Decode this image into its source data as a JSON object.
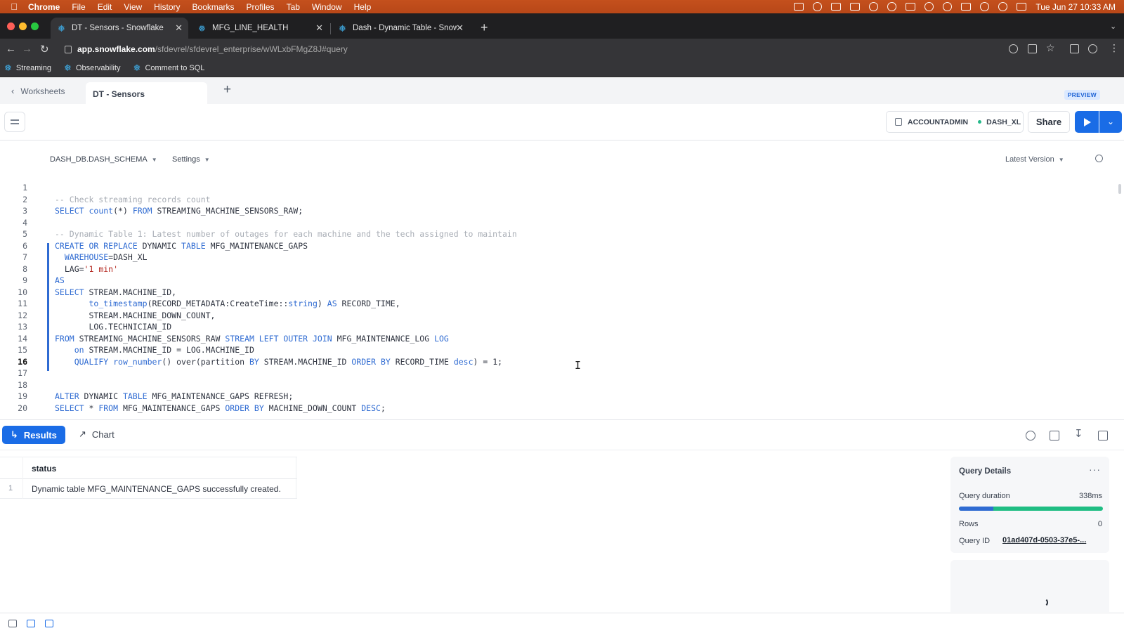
{
  "menubar": {
    "app": "Chrome",
    "items": [
      "File",
      "Edit",
      "View",
      "History",
      "Bookmarks",
      "Profiles",
      "Tab",
      "Window",
      "Help"
    ],
    "datetime": "Tue Jun 27  10:33 AM"
  },
  "browser": {
    "tabs": [
      {
        "title": "DT - Sensors - Snowflake",
        "active": true
      },
      {
        "title": "MFG_LINE_HEALTH",
        "active": false
      },
      {
        "title": "Dash - Dynamic Table - Snowfl",
        "active": false
      }
    ],
    "new_tab": "+",
    "url_host": "app.snowflake.com",
    "url_path": "/sfdevrel/sfdevrel_enterprise/wWLxbFMgZ8J#query",
    "bookmarks": [
      "Streaming",
      "Observability",
      "Comment to SQL"
    ]
  },
  "app": {
    "back_label": "Worksheets",
    "worksheet_title": "DT - Sensors",
    "add": "+",
    "preview": "PREVIEW",
    "role": "ACCOUNTADMIN",
    "warehouse": "DASH_XL",
    "share": "Share",
    "database": "DASH_DB.DASH_SCHEMA",
    "settings": "Settings",
    "version": "Latest Version"
  },
  "editor": {
    "current_line": 16,
    "line_numbers": [
      "1",
      "2",
      "3",
      "4",
      "5",
      "6",
      "7",
      "8",
      "9",
      "10",
      "11",
      "12",
      "13",
      "14",
      "15",
      "16",
      "17",
      "18",
      "19",
      "20"
    ]
  },
  "results": {
    "results_label": "Results",
    "chart_label": "Chart",
    "column": "status",
    "row_index": "1",
    "row_value": "Dynamic table MFG_MAINTENANCE_GAPS successfully created."
  },
  "query_details": {
    "title": "Query Details",
    "more": "···",
    "duration_label": "Query duration",
    "duration_value": "338ms",
    "duration_compile_fraction": 0.24,
    "rows_label": "Rows",
    "rows_value": "0",
    "id_label": "Query ID",
    "id_value": "01ad407d-0503-37e5-..."
  },
  "colors": {
    "accent": "#1a6ce6",
    "bar_secondary": "#1fbd83",
    "menubar": "#c4501d"
  }
}
